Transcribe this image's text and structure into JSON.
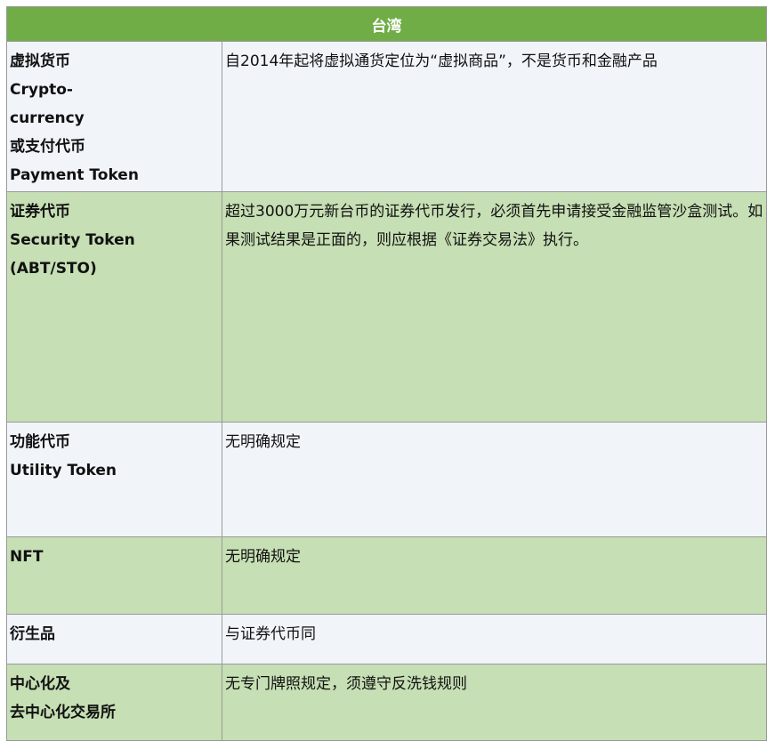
{
  "header": {
    "title": "台湾"
  },
  "rows": [
    {
      "category": [
        "虚拟货币",
        "Crypto-",
        "currency",
        "或支付代币",
        "Payment Token"
      ],
      "description": "自2014年起将虚拟通货定位为“虚拟商品”，不是货币和金融产品"
    },
    {
      "category": [
        "证券代币",
        "Security Token",
        "(ABT/STO)"
      ],
      "description": "超过3000万元新台币的证券代币发行，必须首先申请接受金融监管沙盒测试。如果测试结果是正面的，则应根据《证券交易法》执行。"
    },
    {
      "category": [
        "功能代币",
        "Utility Token"
      ],
      "description": "无明确规定"
    },
    {
      "category": [
        "NFT"
      ],
      "description": "无明确规定"
    },
    {
      "category": [
        "衍生品"
      ],
      "description": "与证券代币同"
    },
    {
      "category": [
        "中心化及",
        "去中心化交易所"
      ],
      "description": "无专门牌照规定，须遵守反洗钱规则"
    }
  ],
  "colors": {
    "header_bg": "#70ad47",
    "row_light": "#f1f5fa",
    "row_green": "#c6dfb4"
  }
}
